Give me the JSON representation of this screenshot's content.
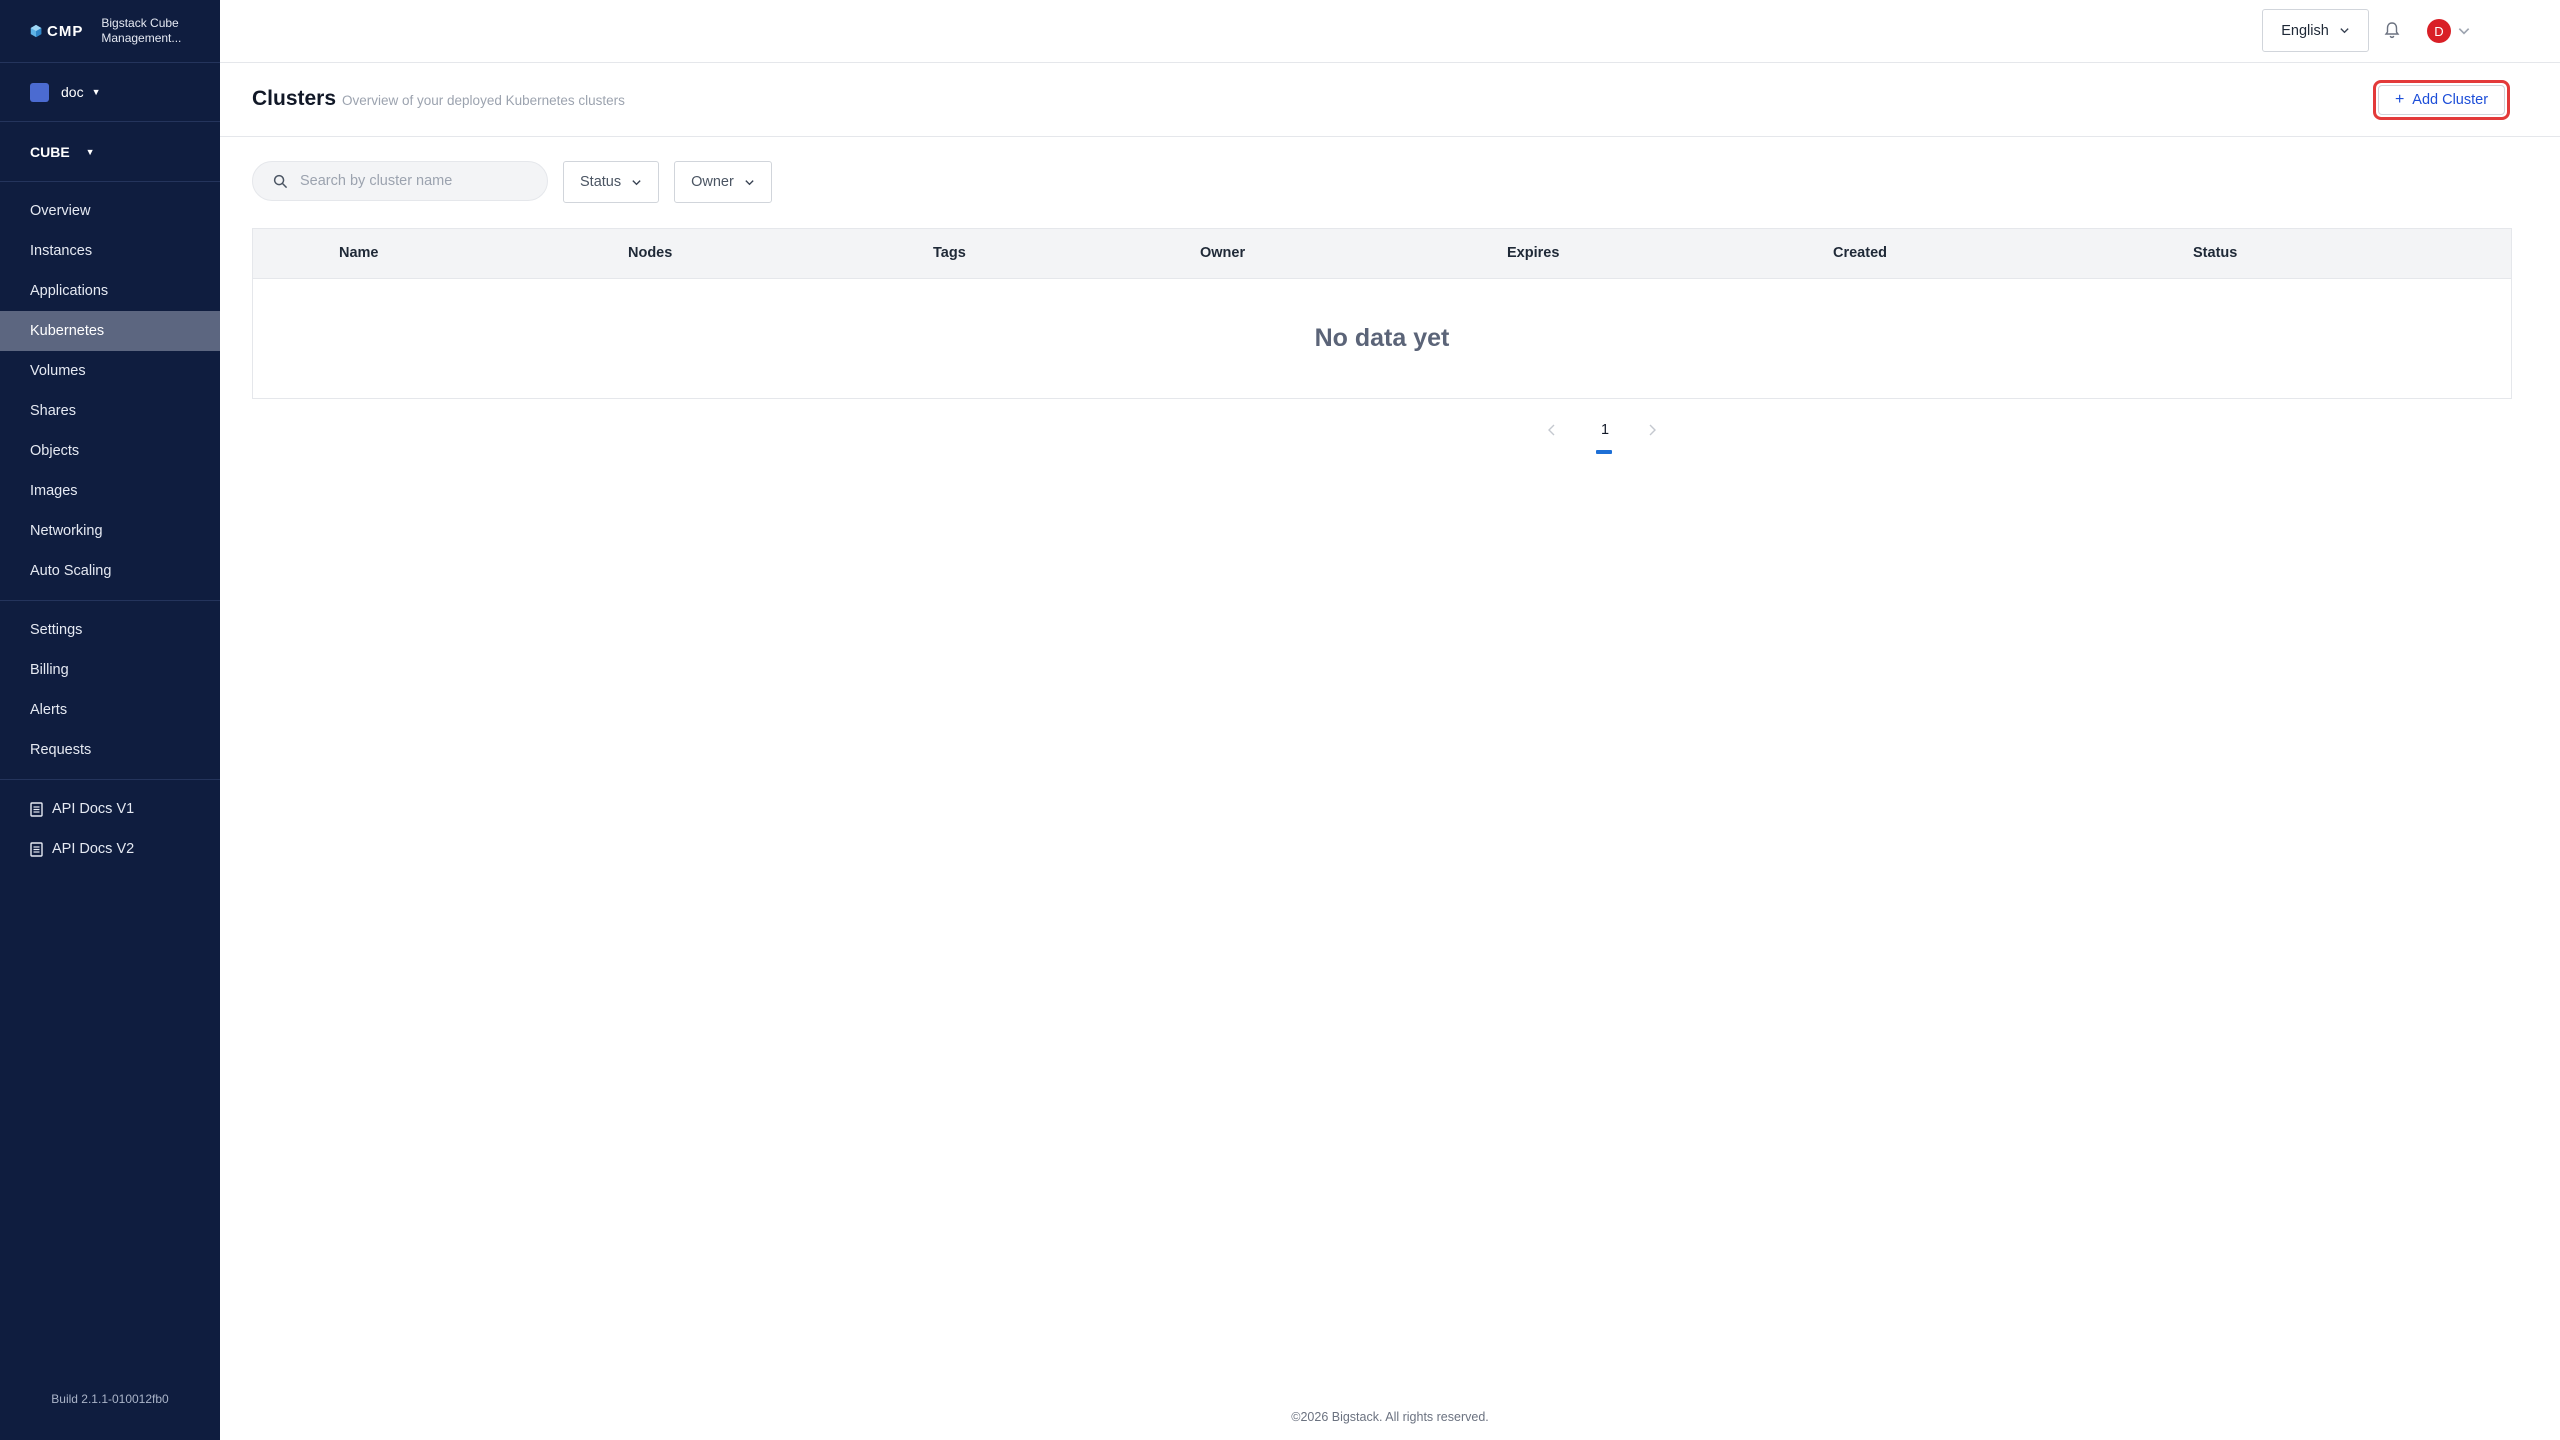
{
  "brand": {
    "short": "CMP",
    "name": "Bigstack Cube Management...",
    "icon": "cube-icon"
  },
  "project": {
    "name": "doc",
    "color": "#4b6bd1"
  },
  "region": {
    "name": "CUBE"
  },
  "nav": {
    "main": [
      "Overview",
      "Instances",
      "Applications",
      "Kubernetes",
      "Volumes",
      "Shares",
      "Objects",
      "Images",
      "Networking",
      "Auto Scaling"
    ],
    "active": "Kubernetes",
    "secondary": [
      "Settings",
      "Billing",
      "Alerts",
      "Requests"
    ],
    "docs": [
      "API Docs V1",
      "API Docs V2"
    ]
  },
  "build": "Build 2.1.1-010012fb0",
  "topbar": {
    "language": "English",
    "avatar_initial": "D",
    "avatar_color": "#d91f26"
  },
  "page": {
    "title": "Clusters",
    "subtitle": "Overview of your deployed Kubernetes clusters",
    "add_button": "Add Cluster"
  },
  "filters": {
    "search_placeholder": "Search by cluster name",
    "status": "Status",
    "owner": "Owner"
  },
  "table": {
    "columns": [
      "Name",
      "Nodes",
      "Tags",
      "Owner",
      "Expires",
      "Created",
      "Status"
    ],
    "empty": "No data yet"
  },
  "pagination": {
    "current_page": "1"
  },
  "footer": "©2026 Bigstack. All rights reserved.",
  "colors": {
    "sidebar": "#0f1d3f",
    "accent": "#1d4ed8",
    "highlight": "#e33a3a"
  }
}
